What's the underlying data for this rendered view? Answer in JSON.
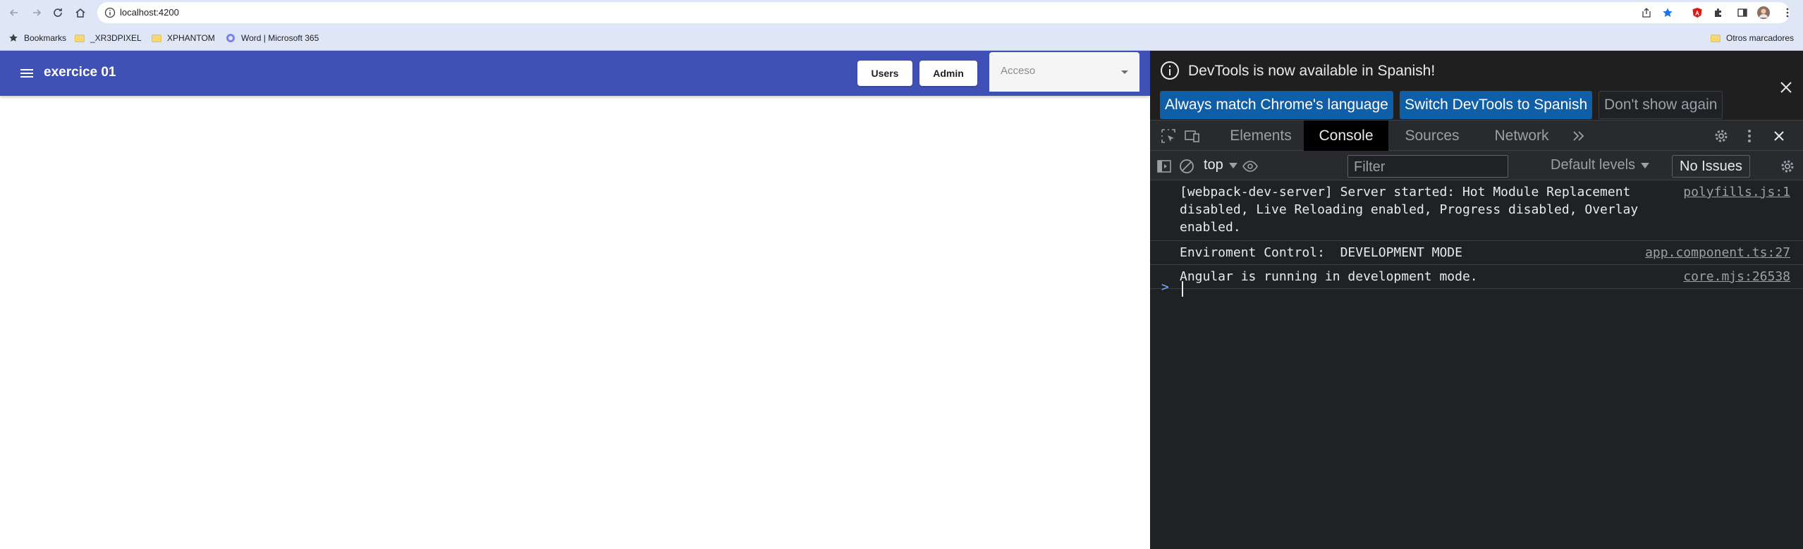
{
  "browser": {
    "url": "localhost:4200",
    "bookmarks": [
      {
        "label": "Bookmarks",
        "icon": "star-icon"
      },
      {
        "label": "_XR3DPIXEL",
        "icon": "folder-icon"
      },
      {
        "label": "XPHANTOM",
        "icon": "folder-icon"
      },
      {
        "label": "Word | Microsoft 365",
        "icon": "microsoft-365-icon"
      }
    ],
    "other_bookmarks": "Otros marcadores"
  },
  "app": {
    "title": "exercice 01",
    "buttons": {
      "users": "Users",
      "admin": "Admin"
    },
    "select": {
      "placeholder": "Acceso"
    },
    "toolbar_color": "#3f51b5"
  },
  "devtools": {
    "banner": {
      "message": "DevTools is now available in Spanish!",
      "match_button": "Always match Chrome's language",
      "switch_button": "Switch DevTools to Spanish",
      "dismiss_button": "Don't show again"
    },
    "tabs": [
      "Elements",
      "Console",
      "Sources",
      "Network"
    ],
    "active_tab": "Console",
    "console_bar": {
      "context": "top",
      "filter_placeholder": "Filter",
      "levels": "Default levels",
      "issues": "No Issues"
    },
    "logs": [
      {
        "message": "[webpack-dev-server] Server started: Hot Module Replacement disabled, Live Reloading enabled, Progress disabled, Overlay enabled.",
        "source": "polyfills.js:1"
      },
      {
        "message": "Enviroment Control:  DEVELOPMENT MODE",
        "source": "app.component.ts:27"
      },
      {
        "message": "Angular is running in development mode.",
        "source": "core.mjs:26538"
      }
    ]
  }
}
